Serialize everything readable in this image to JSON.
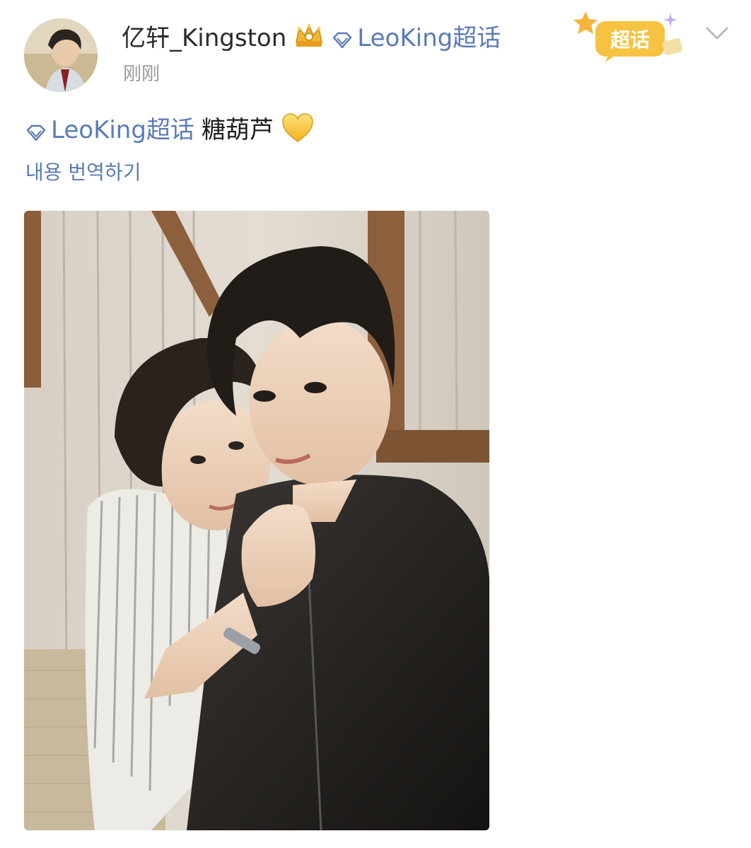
{
  "post": {
    "author": "亿轩_Kingston",
    "author_topic": "LeoKing超话",
    "timestamp": "刚刚",
    "badge_label": "超话",
    "text_topic": "LeoKing超话",
    "text_body": "糖葫芦",
    "translate_label": "내용 번역하기"
  },
  "colors": {
    "link": "#5a7bb5",
    "timestamp": "#9a9a9a",
    "badge": "#f5c242"
  },
  "icons": [
    "crown-icon",
    "diamond-icon",
    "chevron-down-icon",
    "yellow-heart-icon"
  ]
}
